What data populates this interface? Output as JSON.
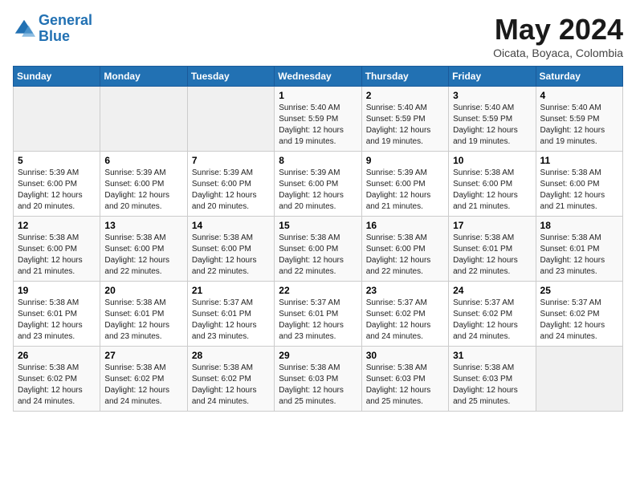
{
  "header": {
    "logo_line1": "General",
    "logo_line2": "Blue",
    "month": "May 2024",
    "location": "Oicata, Boyaca, Colombia"
  },
  "weekdays": [
    "Sunday",
    "Monday",
    "Tuesday",
    "Wednesday",
    "Thursday",
    "Friday",
    "Saturday"
  ],
  "weeks": [
    [
      {
        "day": "",
        "info": ""
      },
      {
        "day": "",
        "info": ""
      },
      {
        "day": "",
        "info": ""
      },
      {
        "day": "1",
        "info": "Sunrise: 5:40 AM\nSunset: 5:59 PM\nDaylight: 12 hours and 19 minutes."
      },
      {
        "day": "2",
        "info": "Sunrise: 5:40 AM\nSunset: 5:59 PM\nDaylight: 12 hours and 19 minutes."
      },
      {
        "day": "3",
        "info": "Sunrise: 5:40 AM\nSunset: 5:59 PM\nDaylight: 12 hours and 19 minutes."
      },
      {
        "day": "4",
        "info": "Sunrise: 5:40 AM\nSunset: 5:59 PM\nDaylight: 12 hours and 19 minutes."
      }
    ],
    [
      {
        "day": "5",
        "info": "Sunrise: 5:39 AM\nSunset: 6:00 PM\nDaylight: 12 hours and 20 minutes."
      },
      {
        "day": "6",
        "info": "Sunrise: 5:39 AM\nSunset: 6:00 PM\nDaylight: 12 hours and 20 minutes."
      },
      {
        "day": "7",
        "info": "Sunrise: 5:39 AM\nSunset: 6:00 PM\nDaylight: 12 hours and 20 minutes."
      },
      {
        "day": "8",
        "info": "Sunrise: 5:39 AM\nSunset: 6:00 PM\nDaylight: 12 hours and 20 minutes."
      },
      {
        "day": "9",
        "info": "Sunrise: 5:39 AM\nSunset: 6:00 PM\nDaylight: 12 hours and 21 minutes."
      },
      {
        "day": "10",
        "info": "Sunrise: 5:38 AM\nSunset: 6:00 PM\nDaylight: 12 hours and 21 minutes."
      },
      {
        "day": "11",
        "info": "Sunrise: 5:38 AM\nSunset: 6:00 PM\nDaylight: 12 hours and 21 minutes."
      }
    ],
    [
      {
        "day": "12",
        "info": "Sunrise: 5:38 AM\nSunset: 6:00 PM\nDaylight: 12 hours and 21 minutes."
      },
      {
        "day": "13",
        "info": "Sunrise: 5:38 AM\nSunset: 6:00 PM\nDaylight: 12 hours and 22 minutes."
      },
      {
        "day": "14",
        "info": "Sunrise: 5:38 AM\nSunset: 6:00 PM\nDaylight: 12 hours and 22 minutes."
      },
      {
        "day": "15",
        "info": "Sunrise: 5:38 AM\nSunset: 6:00 PM\nDaylight: 12 hours and 22 minutes."
      },
      {
        "day": "16",
        "info": "Sunrise: 5:38 AM\nSunset: 6:00 PM\nDaylight: 12 hours and 22 minutes."
      },
      {
        "day": "17",
        "info": "Sunrise: 5:38 AM\nSunset: 6:01 PM\nDaylight: 12 hours and 22 minutes."
      },
      {
        "day": "18",
        "info": "Sunrise: 5:38 AM\nSunset: 6:01 PM\nDaylight: 12 hours and 23 minutes."
      }
    ],
    [
      {
        "day": "19",
        "info": "Sunrise: 5:38 AM\nSunset: 6:01 PM\nDaylight: 12 hours and 23 minutes."
      },
      {
        "day": "20",
        "info": "Sunrise: 5:38 AM\nSunset: 6:01 PM\nDaylight: 12 hours and 23 minutes."
      },
      {
        "day": "21",
        "info": "Sunrise: 5:37 AM\nSunset: 6:01 PM\nDaylight: 12 hours and 23 minutes."
      },
      {
        "day": "22",
        "info": "Sunrise: 5:37 AM\nSunset: 6:01 PM\nDaylight: 12 hours and 23 minutes."
      },
      {
        "day": "23",
        "info": "Sunrise: 5:37 AM\nSunset: 6:02 PM\nDaylight: 12 hours and 24 minutes."
      },
      {
        "day": "24",
        "info": "Sunrise: 5:37 AM\nSunset: 6:02 PM\nDaylight: 12 hours and 24 minutes."
      },
      {
        "day": "25",
        "info": "Sunrise: 5:37 AM\nSunset: 6:02 PM\nDaylight: 12 hours and 24 minutes."
      }
    ],
    [
      {
        "day": "26",
        "info": "Sunrise: 5:38 AM\nSunset: 6:02 PM\nDaylight: 12 hours and 24 minutes."
      },
      {
        "day": "27",
        "info": "Sunrise: 5:38 AM\nSunset: 6:02 PM\nDaylight: 12 hours and 24 minutes."
      },
      {
        "day": "28",
        "info": "Sunrise: 5:38 AM\nSunset: 6:02 PM\nDaylight: 12 hours and 24 minutes."
      },
      {
        "day": "29",
        "info": "Sunrise: 5:38 AM\nSunset: 6:03 PM\nDaylight: 12 hours and 25 minutes."
      },
      {
        "day": "30",
        "info": "Sunrise: 5:38 AM\nSunset: 6:03 PM\nDaylight: 12 hours and 25 minutes."
      },
      {
        "day": "31",
        "info": "Sunrise: 5:38 AM\nSunset: 6:03 PM\nDaylight: 12 hours and 25 minutes."
      },
      {
        "day": "",
        "info": ""
      }
    ]
  ]
}
